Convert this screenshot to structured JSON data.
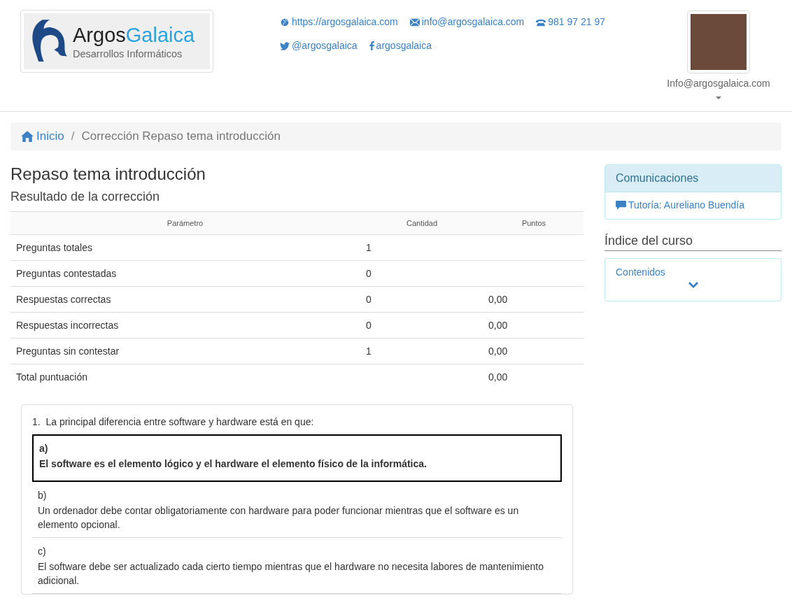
{
  "logo": {
    "name_dark": "Argos",
    "name_light": "Galaica",
    "tagline": "Desarrollos Informáticos"
  },
  "contacts": [
    {
      "kind": "web",
      "text": "https://argosgalaica.com"
    },
    {
      "kind": "mail",
      "text": "info@argosgalaica.com"
    },
    {
      "kind": "phone",
      "text": "981 97 21 97"
    },
    {
      "kind": "twitter",
      "text": "@argosgalaica"
    },
    {
      "kind": "facebook",
      "text": "argosgalaica"
    }
  ],
  "user": {
    "name": "Info@argosgalaica.com"
  },
  "breadcrumb": [
    {
      "kind": "home",
      "label": "Inicio"
    },
    {
      "kind": "current",
      "separator": "/",
      "label": "Corrección Repaso tema introducción"
    }
  ],
  "title": "Repaso tema introducción",
  "subtitle": "Resultado de la corrección",
  "table": {
    "columns": [
      "Parámetro",
      "Cantidad",
      "Puntos"
    ],
    "rows": [
      {
        "parameter": "Preguntas totales",
        "quantity": "1"
      },
      {
        "parameter": "Preguntas contestadas",
        "quantity": "0"
      },
      {
        "parameter": "Respuestas correctas",
        "quantity": "0",
        "points": "0,00"
      },
      {
        "parameter": "Respuestas incorrectas",
        "quantity": "0",
        "points": "0,00"
      },
      {
        "parameter": "Preguntas sin contestar",
        "quantity": "1",
        "points": "0,00"
      },
      {
        "parameter": "Total puntuación",
        "points": "0,00"
      }
    ]
  },
  "question": {
    "number": "1.",
    "text": "La principal diferencia entre software y hardware está en que:",
    "options": [
      {
        "letter": "a)",
        "text": "El software es el elemento lógico y el hardware el elemento físico de la informática.",
        "selected": true
      },
      {
        "letter": "b)",
        "text": "Un ordenador debe contar obligatoriamente con hardware para poder funcionar mientras que el software es un elemento opcional.",
        "selected": false
      },
      {
        "letter": "c)",
        "text": "El software debe ser actualizado cada cierto tiempo mientras que el hardware no necesita labores de mantenimiento adicional.",
        "selected": false
      }
    ]
  },
  "communications": {
    "title": "Comunicaciones",
    "items": [
      {
        "label": "Tutoría: Aureliano Buendía"
      }
    ]
  },
  "course_index": {
    "title": "Índice del curso",
    "panel_link": "Contenidos",
    "expanded": false
  }
}
